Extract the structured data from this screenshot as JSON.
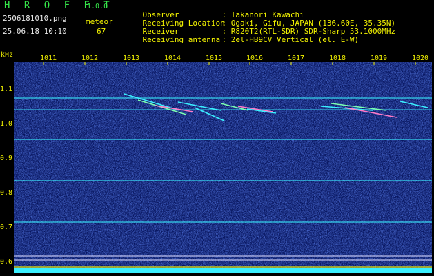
{
  "header": {
    "brand": "H R O F F T",
    "version": "1.0.0",
    "file_name": "2506181010.png",
    "datetime": "25.06.18 10:10",
    "mode": "meteor",
    "count": "67"
  },
  "station": [
    {
      "label": "Observer",
      "value": "Takanori Kawachi"
    },
    {
      "label": "Receiving Location",
      "value": "Ogaki, Gifu, JAPAN (136.60E, 35.35N)"
    },
    {
      "label": "Receiver",
      "value": "R820T2(RTL-SDR) SDR-Sharp 53.1000MHz"
    },
    {
      "label": "Receiving antenna",
      "value": "2el-HB9CV Vertical (el. E-W)"
    }
  ],
  "axis": {
    "y_unit": "kHz",
    "y_ticks": [
      "1.1",
      "1.0",
      "0.9",
      "0.8",
      "0.7",
      "0.6"
    ],
    "x_ticks": [
      "1011",
      "1012",
      "1013",
      "1014",
      "1015",
      "1016",
      "1017",
      "1018",
      "1019",
      "1020"
    ]
  },
  "colors": {
    "background": "#0a1a6a",
    "text": "#f2f200",
    "trace": "#3af0ff",
    "bottom_bar": "#3af0ff"
  }
}
